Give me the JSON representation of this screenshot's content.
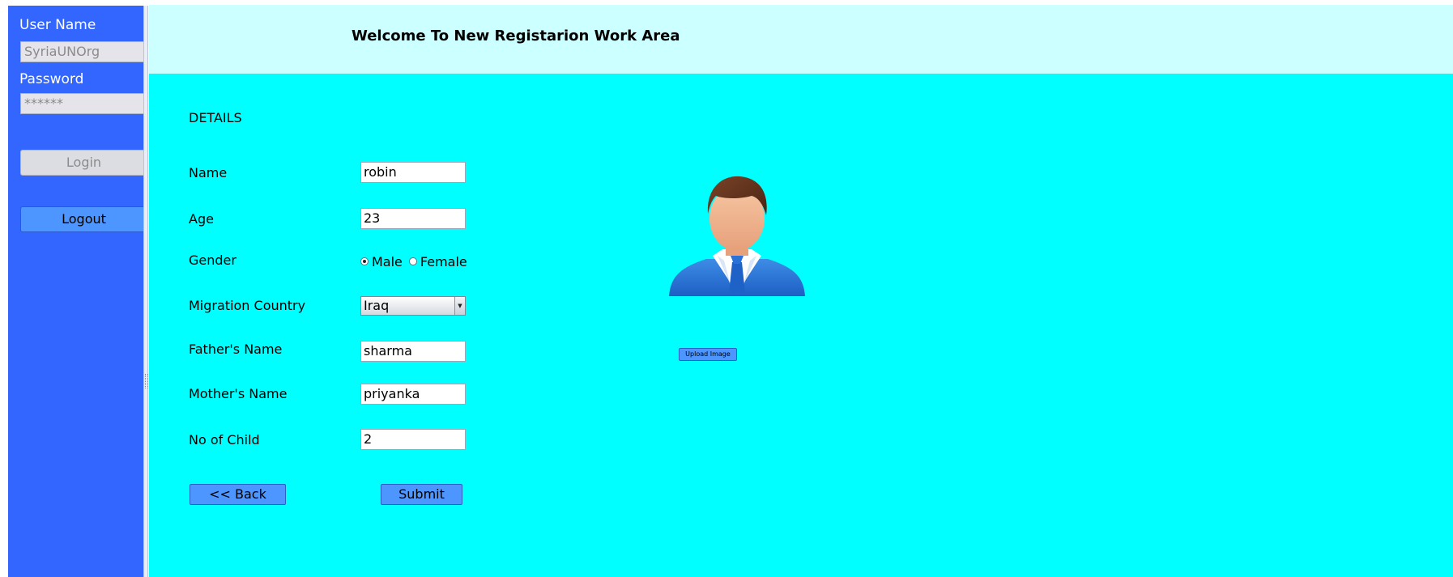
{
  "sidebar": {
    "username_label": "User Name",
    "username_value": "SyriaUNOrg",
    "password_label": "Password",
    "password_value": "******",
    "login_label": "Login",
    "logout_label": "Logout"
  },
  "header": {
    "title": "Welcome To New Registarion Work Area"
  },
  "form": {
    "section_title": "DETAILS",
    "name_label": "Name",
    "name_value": "robin",
    "age_label": "Age",
    "age_value": "23",
    "gender_label": "Gender",
    "gender_options": [
      "Male",
      "Female"
    ],
    "gender_selected": "Male",
    "country_label": "Migration Country",
    "country_value": "Iraq",
    "father_label": "Father's Name",
    "father_value": "sharma",
    "mother_label": "Mother's Name",
    "mother_value": "priyanka",
    "children_label": "No of Child",
    "children_value": "2",
    "back_label": "<<  Back",
    "submit_label": "Submit"
  },
  "image_panel": {
    "upload_label": "Upload Image",
    "avatar_icon": "user-avatar-icon"
  },
  "colors": {
    "sidebar": "#3366ff",
    "header": "#ccffff",
    "main": "#00ffff",
    "button": "#4d95ff"
  }
}
